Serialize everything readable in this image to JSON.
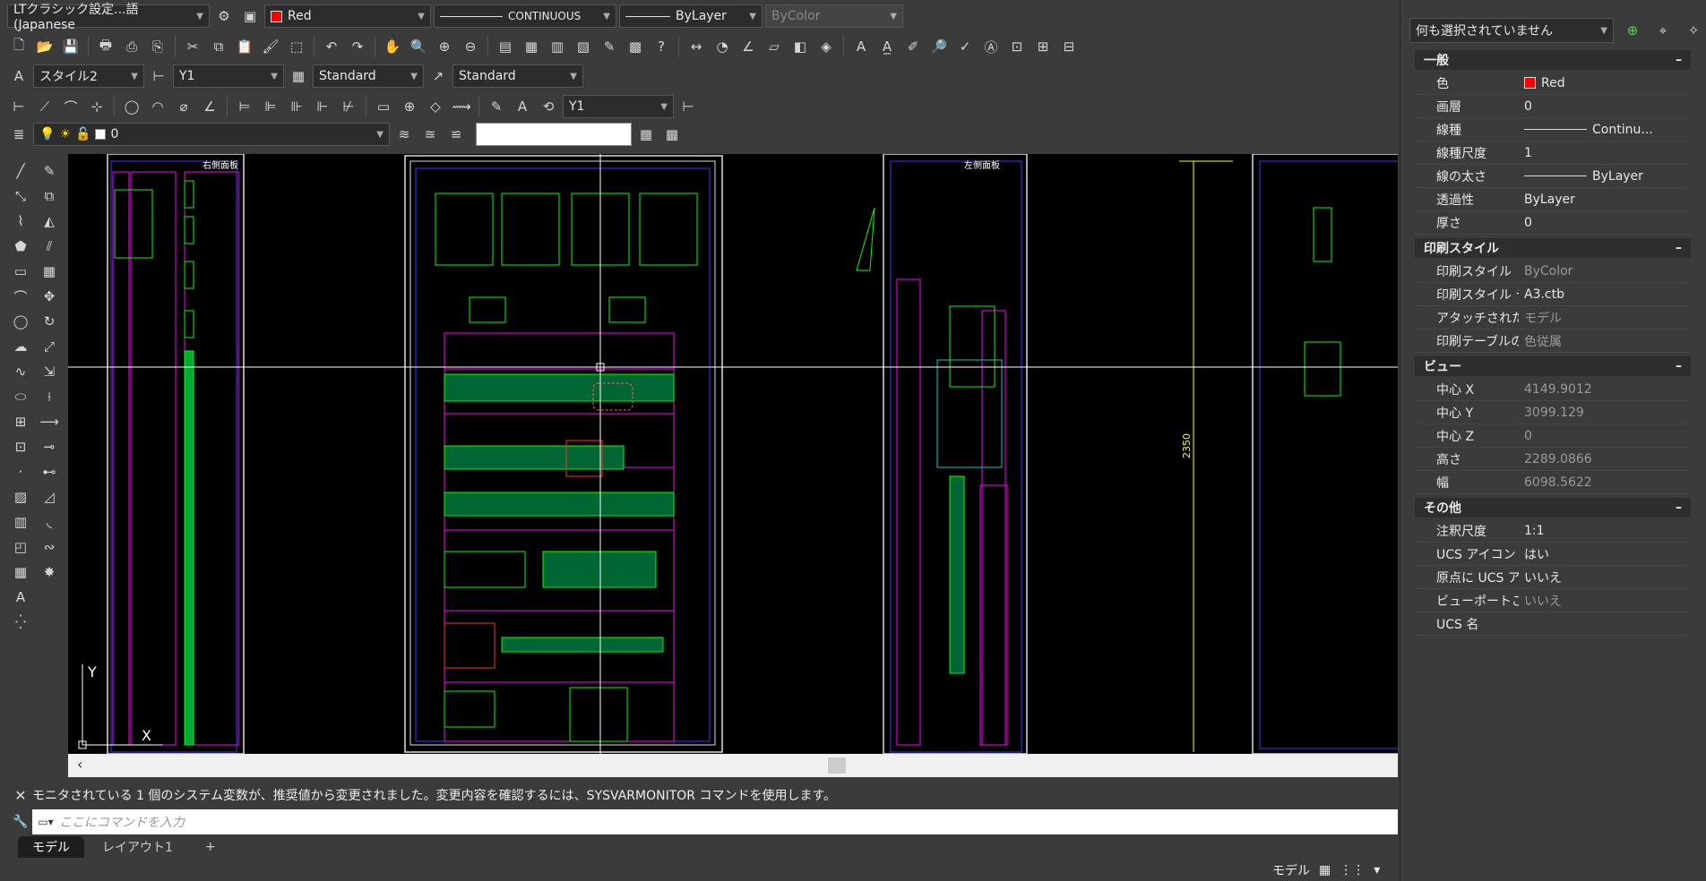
{
  "toolbar1": {
    "workspace": "LTクラシック設定...語 (Japanese",
    "color": "Red",
    "color_hex": "#ff0000",
    "linetype": "CONTINUOUS",
    "lineweight": "ByLayer",
    "plotstyle": "ByColor"
  },
  "toolbar3": {
    "text_style": "スタイル2",
    "dim_style": "Y1",
    "table_style": "Standard",
    "mleader_style": "Standard"
  },
  "toolbar4": {
    "dim_style": "Y1"
  },
  "toolbar5": {
    "layer": "0"
  },
  "canvas": {
    "labels": {
      "right_panel_title": "右側面板",
      "left_panel_title": "左側面板",
      "dimension": "2350",
      "ucs_y": "Y",
      "ucs_x": "X"
    }
  },
  "command": {
    "history": "モニタされている 1 個のシステム変数が、推奨値から変更されました。変更内容を確認するには、SYSVARMONITOR コマンドを使用します。",
    "placeholder": "ここにコマンドを入力"
  },
  "tabs": [
    {
      "label": "モデル"
    },
    {
      "label": "レイアウト1"
    },
    {
      "label": "+"
    }
  ],
  "status": {
    "model": "モデル"
  },
  "palette": {
    "selection": "何も選択されていません",
    "sections": [
      {
        "title": "一般",
        "rows": [
          {
            "k": "色",
            "v": "Red"
          },
          {
            "k": "画層",
            "v": "0"
          },
          {
            "k": "線種",
            "v": "Continu..."
          },
          {
            "k": "線種尺度",
            "v": "1"
          },
          {
            "k": "線の太さ",
            "v": "ByLayer"
          },
          {
            "k": "透過性",
            "v": "ByLayer"
          },
          {
            "k": "厚さ",
            "v": "0"
          }
        ]
      },
      {
        "title": "印刷スタイル",
        "rows": [
          {
            "k": "印刷スタイル",
            "v": "ByColor"
          },
          {
            "k": "印刷スタイル テ...",
            "v": "A3.ctb"
          },
          {
            "k": "アタッチされた印...",
            "v": "モデル"
          },
          {
            "k": "印刷テーブルの...",
            "v": "色従属"
          }
        ]
      },
      {
        "title": "ビュー",
        "rows": [
          {
            "k": "中心 X",
            "v": "4149.9012"
          },
          {
            "k": "中心 Y",
            "v": "3099.129"
          },
          {
            "k": "中心 Z",
            "v": "0"
          },
          {
            "k": "高さ",
            "v": "2289.0866"
          },
          {
            "k": "幅",
            "v": "6098.5622"
          }
        ]
      },
      {
        "title": "その他",
        "rows": [
          {
            "k": "注釈尺度",
            "v": "1:1"
          },
          {
            "k": "UCS アイコン オン",
            "v": "はい"
          },
          {
            "k": "原点に UCS ア...",
            "v": "いいえ"
          },
          {
            "k": "ビューポートごと...",
            "v": "いいえ"
          },
          {
            "k": "UCS 名",
            "v": ""
          }
        ]
      }
    ],
    "collapse": "–"
  }
}
